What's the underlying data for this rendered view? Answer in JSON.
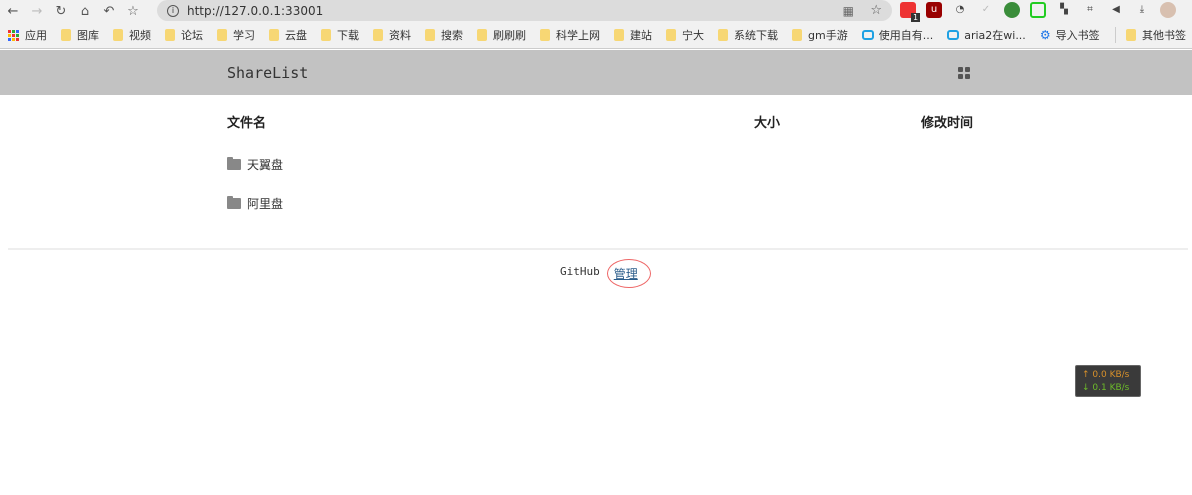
{
  "browser": {
    "url": "http://127.0.0.1:33001",
    "ext_badge": "1",
    "bookmarks": [
      {
        "label": "应用",
        "icon": "apps-icon"
      },
      {
        "label": "图库",
        "icon": "folder-icon"
      },
      {
        "label": "视频",
        "icon": "folder-icon"
      },
      {
        "label": "论坛",
        "icon": "folder-icon"
      },
      {
        "label": "学习",
        "icon": "folder-icon"
      },
      {
        "label": "云盘",
        "icon": "folder-icon"
      },
      {
        "label": "下载",
        "icon": "folder-icon"
      },
      {
        "label": "资料",
        "icon": "folder-icon"
      },
      {
        "label": "搜索",
        "icon": "folder-icon"
      },
      {
        "label": "刷刷刷",
        "icon": "folder-icon"
      },
      {
        "label": "科学上网",
        "icon": "folder-icon"
      },
      {
        "label": "建站",
        "icon": "folder-icon"
      },
      {
        "label": "宁大",
        "icon": "folder-icon"
      },
      {
        "label": "系统下载",
        "icon": "folder-icon"
      },
      {
        "label": "gm手游",
        "icon": "folder-icon"
      },
      {
        "label": "使用自有...",
        "icon": "bilibili-icon"
      },
      {
        "label": "aria2在wi...",
        "icon": "bilibili-icon"
      },
      {
        "label": "导入书签",
        "icon": "gear-icon"
      }
    ],
    "other_bookmarks": "其他书签"
  },
  "app": {
    "title": "ShareList"
  },
  "table": {
    "headers": [
      "文件名",
      "大小",
      "修改时间"
    ],
    "rows": [
      {
        "name": "天翼盘",
        "size": "",
        "modified": ""
      },
      {
        "name": "阿里盘",
        "size": "",
        "modified": ""
      }
    ]
  },
  "footer": {
    "github": "GitHub",
    "admin": "管理"
  },
  "speed": {
    "up": "↑ 0.0 KB/s",
    "down": "↓ 0.1 KB/s",
    "up_color": "#d9912a",
    "down_color": "#6dbb2a"
  }
}
